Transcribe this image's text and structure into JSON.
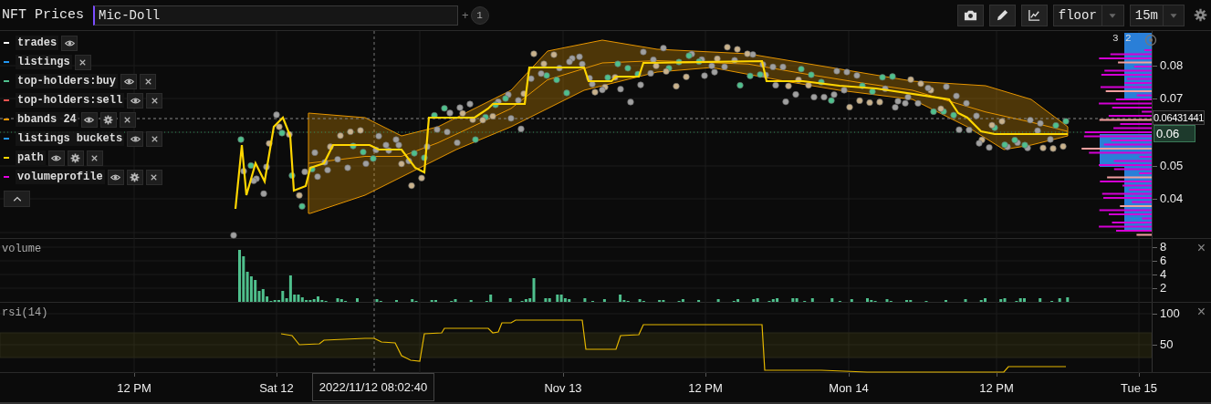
{
  "app": {
    "title": "NFT Prices"
  },
  "search": {
    "value": "Mic-Doll"
  },
  "compare": {
    "plus": "+",
    "count": "1"
  },
  "toolbar": {
    "buttons": [
      {
        "kind": "camera"
      },
      {
        "kind": "pencil"
      },
      {
        "kind": "chart"
      }
    ],
    "dropdowns": [
      {
        "value": "floor"
      },
      {
        "value": "15m"
      }
    ]
  },
  "legend": [
    {
      "label": "trades",
      "color": "#ffffff",
      "has_visibility": true,
      "has_settings": false,
      "has_remove": false
    },
    {
      "label": "listings",
      "color": "#2196f3",
      "has_visibility": false,
      "has_settings": false,
      "has_remove": true
    },
    {
      "label": "top-holders:buy",
      "color": "#4fc08d",
      "has_visibility": true,
      "has_settings": false,
      "has_remove": true
    },
    {
      "label": "top-holders:sell",
      "color": "#ef5350",
      "has_visibility": true,
      "has_settings": false,
      "has_remove": true
    },
    {
      "label": "bbands 24",
      "color": "#ff9800",
      "has_visibility": true,
      "has_settings": true,
      "has_remove": true
    },
    {
      "label": "listings buckets",
      "color": "#2196f3",
      "has_visibility": true,
      "has_settings": false,
      "has_remove": true
    },
    {
      "label": "path",
      "color": "#ffd600",
      "has_visibility": true,
      "has_settings": true,
      "has_remove": true
    },
    {
      "label": "volumeprofile",
      "color": "#e000e0",
      "has_visibility": true,
      "has_settings": true,
      "has_remove": true
    }
  ],
  "price_axis": {
    "counts": [
      "3",
      "2"
    ],
    "ticks": [
      "0.08",
      "0.07",
      "0.05",
      "0.04"
    ],
    "crosshair_value": "0.06431441",
    "last_value": "0.06"
  },
  "volume_pane": {
    "title": "volume",
    "close": "×",
    "ticks": [
      "8",
      "6",
      "4",
      "2"
    ]
  },
  "rsi_pane": {
    "title": "rsi(14)",
    "close": "×",
    "ticks": [
      "100",
      "50"
    ]
  },
  "time_axis": {
    "labels": [
      "12 PM",
      "Sat 12",
      "Nov 13",
      "12 PM",
      "Mon 14",
      "12 PM",
      "Tue 15"
    ],
    "crosshair_time": "2022/11/12 08:02:40"
  }
}
